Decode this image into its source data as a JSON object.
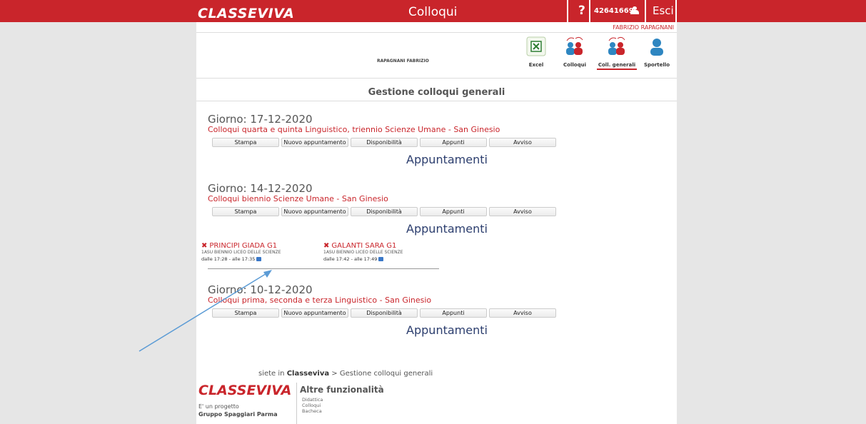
{
  "header": {
    "brand": "CLASSEVIVA",
    "title": "Colloqui",
    "help": "?",
    "user_code": "42641669",
    "logout": "Esci",
    "user_fullname": "FABRIZIO RAPAGNANI"
  },
  "student_name": "RAPAGNANI FABRIZIO",
  "tools": [
    {
      "label": "Excel",
      "icon": "excel-icon"
    },
    {
      "label": "Colloqui",
      "icon": "parents-icon"
    },
    {
      "label": "Coll. generali",
      "icon": "group-parents-icon",
      "active": true
    },
    {
      "label": "Sportello",
      "icon": "person-icon"
    }
  ],
  "page_title": "Gestione colloqui generali",
  "buttons": [
    "Stampa",
    "Nuovo appuntamento",
    "Disponibilità",
    "Appunti",
    "Avviso"
  ],
  "days": [
    {
      "heading": "Giorno:  17-12-2020",
      "subtitle": "Colloqui quarta e quinta Linguistico, triennio Scienze Umane - San Ginesio",
      "appointments_label": "Appuntamenti"
    },
    {
      "heading": "Giorno:  14-12-2020",
      "subtitle": "Colloqui biennio Scienze Umane - San Ginesio",
      "appointments_label": "Appuntamenti",
      "appointments": [
        {
          "name": "PRINCIPI GIADA G1",
          "class": "1ASU BIENNIO LICEO DELLE SCIENZE",
          "time": "dalle 17:28 - alle 17:35"
        },
        {
          "name": "GALANTI SARA G1",
          "class": "1ASU BIENNIO LICEO DELLE SCIENZE",
          "time": "dalle 17:42 - alle 17:49"
        }
      ]
    },
    {
      "heading": "Giorno:  10-12-2020",
      "subtitle": "Colloqui prima, seconda e terza Linguistico - San Ginesio",
      "appointments_label": "Appuntamenti"
    }
  ],
  "footer": {
    "breadcrumb_prefix": "siete in ",
    "breadcrumb_site": "Classeviva",
    "breadcrumb_rest": " > Gestione colloqui generali",
    "logo": "CLASSEVIVA",
    "project_line1": "E' un progetto",
    "project_line2": "Gruppo Spaggiari Parma",
    "more_title": "Altre funzionalità",
    "links": [
      "Didattica",
      "Colloqui",
      "Bacheca"
    ]
  },
  "colors": {
    "brand_red": "#c9252b",
    "link_blue": "#2c3e6e",
    "arrow_blue": "#5b9bd5"
  }
}
